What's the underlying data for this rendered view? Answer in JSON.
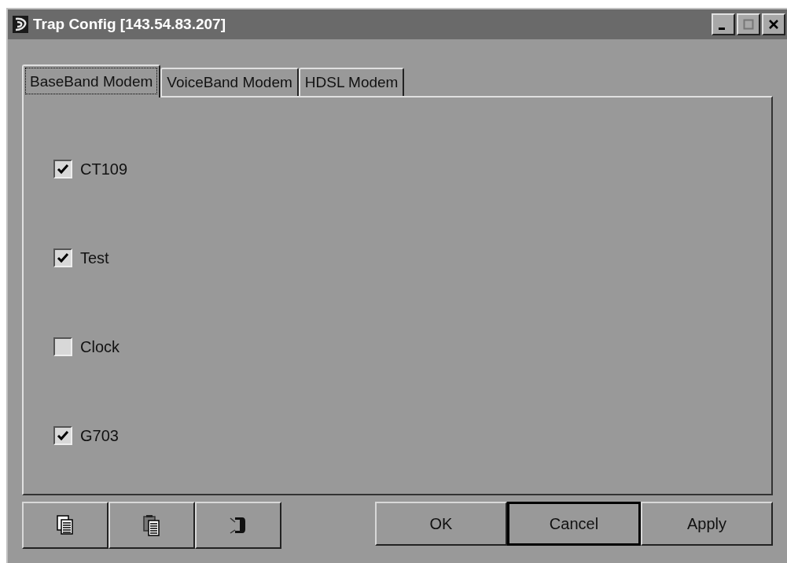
{
  "window": {
    "title": "Trap Config [143.54.83.207]",
    "controls": [
      {
        "kind": "minimize"
      },
      {
        "kind": "maximize"
      },
      {
        "kind": "close"
      }
    ]
  },
  "tabs": [
    {
      "label": "BaseBand Modem",
      "selected": true
    },
    {
      "label": "VoiceBand Modem",
      "selected": false
    },
    {
      "label": "HDSL Modem",
      "selected": false
    }
  ],
  "checkboxes": [
    {
      "label": "CT109",
      "checked": true
    },
    {
      "label": "Test",
      "checked": true
    },
    {
      "label": "Clock",
      "checked": false
    },
    {
      "label": "G703",
      "checked": true
    }
  ],
  "tool_buttons": [
    {
      "kind": "copy"
    },
    {
      "kind": "paste"
    },
    {
      "kind": "clear"
    }
  ],
  "buttons": [
    {
      "label": "OK",
      "default": false
    },
    {
      "label": "Cancel",
      "default": true
    },
    {
      "label": "Apply",
      "default": false
    }
  ]
}
